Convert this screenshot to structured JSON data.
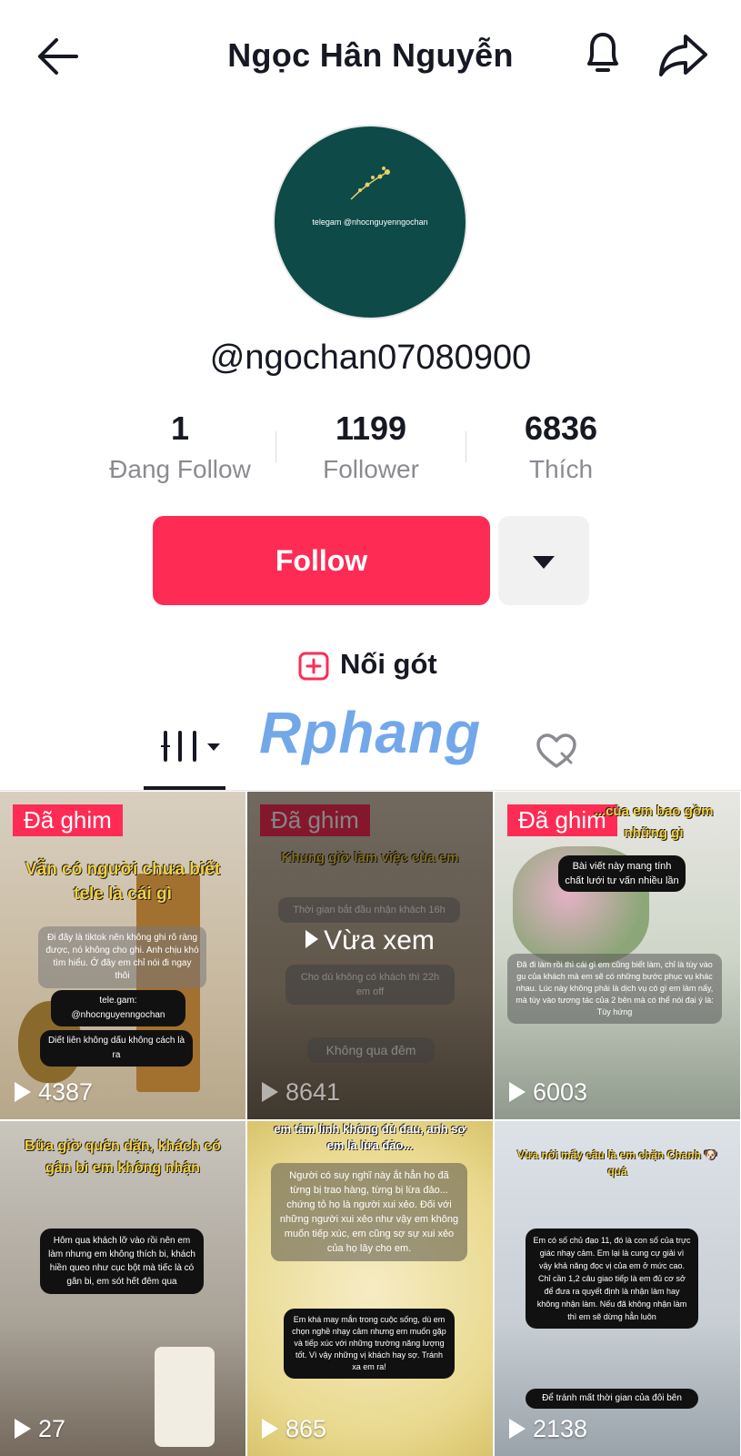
{
  "header": {
    "title": "Ngọc Hân Nguyễn"
  },
  "profile": {
    "avatar_text": "telegam @nhocnguyenngochan",
    "handle": "@ngochan07080900",
    "stats": [
      {
        "value": "1",
        "label": "Đang Follow"
      },
      {
        "value": "1199",
        "label": "Follower"
      },
      {
        "value": "6836",
        "label": "Thích"
      }
    ],
    "follow_label": "Follow",
    "noigot_label": "Nối gót"
  },
  "watermark": "Rphang",
  "colors": {
    "accent": "#fe2c55",
    "text": "#161823",
    "muted": "#8a8b91"
  },
  "videos": [
    {
      "pinned": "Đã ghim",
      "views": "4387",
      "headline": "Vẫn có người chưa biết tele là cái gì",
      "body": "Đi đây là tiktok nên không ghi rõ ràng được, nó không cho ghi. Anh chịu khó tìm hiểu. Ở đây em chỉ nói đi ngay thôi",
      "tele": "tele.gam: @nhocnguyenngochan",
      "footer": "Diết liên không dấu không cách là ra"
    },
    {
      "pinned": "Đã ghim",
      "views": "8641",
      "headline": "Khung giờ làm việc của em",
      "line1": "Thời gian bắt đầu nhận khách 16h",
      "line2": "Cho dù không có khách thì 22h em off",
      "line3": "Không qua đêm",
      "seen_label": "Vừa xem"
    },
    {
      "pinned": "Đã ghim",
      "views": "6003",
      "headline": "...của em bao gồm những gì",
      "note": "Bài viết này mang tính chất lưới tư vấn nhiều lần",
      "body": "Đã đi làm rồi thì cái gì em cũng biết làm, chỉ là tùy vào gu của khách mà em sẽ có những bước phục vụ khác nhau. Lúc này không phải là dịch vụ có gì em làm nấy, mà tùy vào tương tác của 2 bên mà có thể nói đại ý là: Tùy hứng"
    },
    {
      "views": "27",
      "headline": "Bữa giờ quên dặn, khách có gân bi em không nhận",
      "body": "Hôm qua khách lỡ vào rồi nên em làm nhưng em không thích bi, khách hiền queo như cục bột mà tiếc là có gân bi, em sót hết đêm qua"
    },
    {
      "views": "865",
      "headline": "em tâm linh không đủ đau, anh sợ em là lừa đảo...",
      "body1": "Người có suy nghĩ này ắt hẳn họ đã từng bị trao hàng, từng bị lừa đảo... chứng tỏ họ là người xui xẻo. Đối với những người xui xẻo như vậy em không muốn tiếp xúc, em cũng sợ sự xui xẻo của họ lây cho em.",
      "body2": "Em khá may mắn trong cuộc sống, dù em chọn nghề nhạy cảm nhưng em muốn gặp và tiếp xúc với những trường năng lượng tốt. Vì vậy những vị khách hay sợ. Tránh xa em ra!"
    },
    {
      "views": "2138",
      "headline": "Vừa nói mấy câu là em chặn Chanh 🐶 quá",
      "body": "Em có số chủ đạo 11, đó là con số của trực giác nhạy cảm. Em lại là cung cự giải vì vậy khả năng đọc vị của em ở mức cao. Chỉ cần 1,2 câu giao tiếp là em đủ cơ sở để đưa ra quyết định là nhận làm hay không nhận làm. Nếu đã không nhận làm thì em sẽ dừng hẳn luôn",
      "footer": "Để tránh mất thời gian của đôi bên"
    }
  ]
}
